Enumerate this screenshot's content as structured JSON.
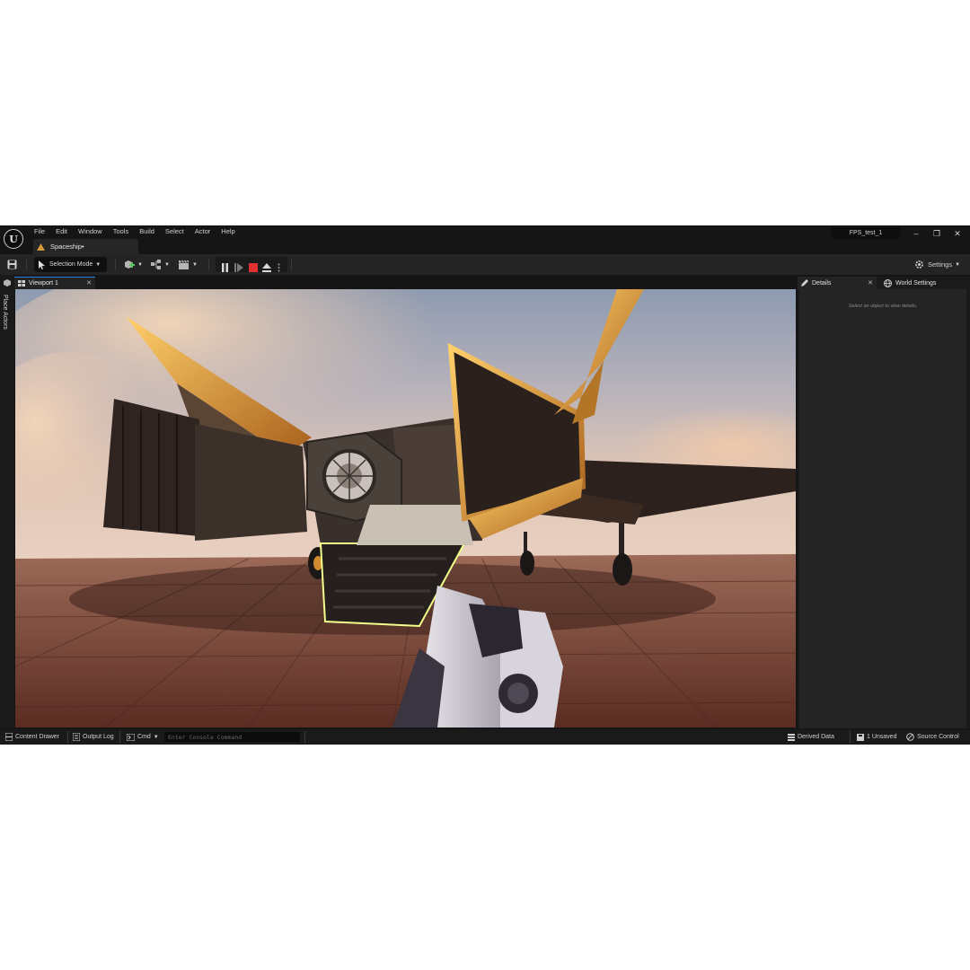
{
  "window": {
    "document_tab": "Spaceship•",
    "project_name": "FPS_test_1",
    "controls": {
      "minimize": "–",
      "restore": "❐",
      "close": "✕"
    }
  },
  "menu": [
    "File",
    "Edit",
    "Window",
    "Tools",
    "Build",
    "Select",
    "Actor",
    "Help"
  ],
  "toolbar": {
    "selection_mode": "Selection Mode",
    "settings": "Settings"
  },
  "left_strip": {
    "label": "Place Actors"
  },
  "viewport": {
    "tab_label": "Viewport 1",
    "close": "✕"
  },
  "details": {
    "tab_label": "Details",
    "close": "✕",
    "world_settings_label": "World Settings",
    "empty_message": "Select an object to view details."
  },
  "statusbar": {
    "content_drawer": "Content Drawer",
    "output_log": "Output Log",
    "cmd": "Cmd",
    "console_placeholder": "Enter Console Command",
    "derived_data": "Derived Data",
    "unsaved": "1 Unsaved",
    "source_control": "Source Control"
  },
  "colors": {
    "accent": "#2a7de1",
    "stop": "#e03030",
    "panel": "#242424",
    "background": "#151515"
  }
}
